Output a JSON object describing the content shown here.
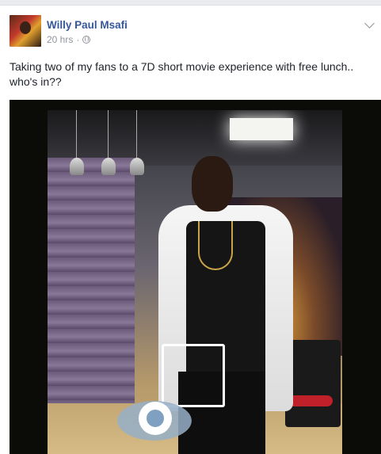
{
  "post": {
    "author": "Willy Paul Msafi",
    "time": "20 hrs",
    "separator": "·",
    "text": "Taking two of my fans to a 7D short movie experience with free lunch.. who's in??"
  },
  "icons": {
    "privacy": "globe-icon",
    "menu": "chevron-down-icon",
    "overlay": "eye-icon"
  },
  "colors": {
    "author_link": "#365899",
    "meta_text": "#90949c",
    "body_text": "#1d2129",
    "feed_background": "#e9ebee"
  }
}
